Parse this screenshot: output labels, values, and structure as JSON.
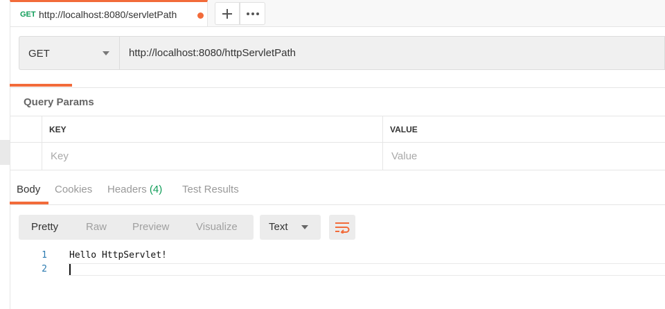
{
  "tab": {
    "method": "GET",
    "title": "http://localhost:8080/servletPath",
    "unsaved_color": "#f26b3a"
  },
  "request": {
    "method": "GET",
    "url": "http://localhost:8080/httpServletPath"
  },
  "query_params": {
    "title": "Query Params",
    "columns": [
      "KEY",
      "VALUE"
    ],
    "key_placeholder": "Key",
    "value_placeholder": "Value"
  },
  "response_tabs": [
    {
      "label": "Body"
    },
    {
      "label": "Cookies"
    },
    {
      "label": "Headers",
      "count": "(4)"
    },
    {
      "label": "Test Results"
    }
  ],
  "format": {
    "buttons": [
      "Pretty",
      "Raw",
      "Preview",
      "Visualize"
    ],
    "language": "Text"
  },
  "code_lines": [
    {
      "num": "1",
      "text": "Hello HttpServlet!"
    },
    {
      "num": "2",
      "text": ""
    }
  ],
  "icons": [
    "plus-icon",
    "more-dots-icon",
    "caret-down-icon",
    "wrap-lines-icon"
  ],
  "colors": {
    "accent": "#f26b3a",
    "method_get": "#0f9d58",
    "line_number": "#2a7ab0"
  }
}
